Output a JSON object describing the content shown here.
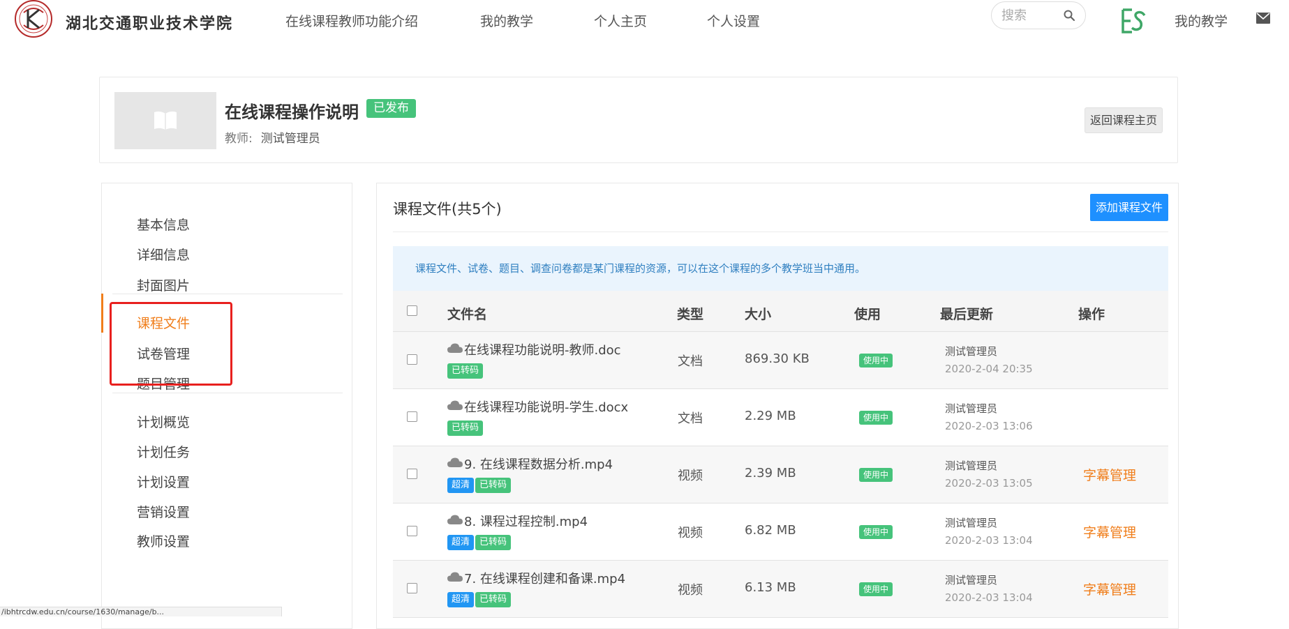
{
  "header": {
    "school_name": "湖北交通职业技术学院",
    "nav": [
      "在线课程教师功能介绍",
      "我的教学",
      "个人主页",
      "个人设置"
    ],
    "search_placeholder": "搜索",
    "my_teaching": "我的教学"
  },
  "course": {
    "title": "在线课程操作说明",
    "status": "已发布",
    "teacher_label": "教师:",
    "teacher_name": "测试管理员",
    "back_label": "返回课程主页"
  },
  "sidebar": {
    "items": [
      "基本信息",
      "详细信息",
      "封面图片",
      "课程文件",
      "试卷管理",
      "题目管理",
      "计划概览",
      "计划任务",
      "计划设置",
      "营销设置",
      "教师设置"
    ],
    "active": "课程文件"
  },
  "main": {
    "title": "课程文件(共5个)",
    "add_label": "添加课程文件",
    "notice": "课程文件、试卷、题目、调查问卷都是某门课程的资源，可以在这个课程的多个教学班当中通用。",
    "columns": [
      "文件名",
      "类型",
      "大小",
      "使用",
      "最后更新",
      "操作"
    ],
    "rows": [
      {
        "name": "在线课程功能说明-教师.doc",
        "tags": [
          "已转码"
        ],
        "type": "文档",
        "size": "869.30 KB",
        "use": "使用中",
        "updater": "测试管理员",
        "time": "2020-2-04 20:35",
        "action": ""
      },
      {
        "name": "在线课程功能说明-学生.docx",
        "tags": [
          "已转码"
        ],
        "type": "文档",
        "size": "2.29 MB",
        "use": "使用中",
        "updater": "测试管理员",
        "time": "2020-2-03 13:06",
        "action": ""
      },
      {
        "name": "9. 在线课程数据分析.mp4",
        "tags": [
          "超清",
          "已转码"
        ],
        "type": "视频",
        "size": "2.39 MB",
        "use": "使用中",
        "updater": "测试管理员",
        "time": "2020-2-03 13:05",
        "action": "字幕管理"
      },
      {
        "name": "8. 课程过程控制.mp4",
        "tags": [
          "超清",
          "已转码"
        ],
        "type": "视频",
        "size": "6.82 MB",
        "use": "使用中",
        "updater": "测试管理员",
        "time": "2020-2-03 13:04",
        "action": "字幕管理"
      },
      {
        "name": "7. 在线课程创建和备课.mp4",
        "tags": [
          "超清",
          "已转码"
        ],
        "type": "视频",
        "size": "6.13 MB",
        "use": "使用中",
        "updater": "测试管理员",
        "time": "2020-2-03 13:04",
        "action": "字幕管理"
      }
    ]
  },
  "status_url": "/ibhtrcdw.edu.cn/course/1630/manage/b...",
  "colors": {
    "accent": "#f07e1b",
    "green": "#46c37b",
    "blue": "#1e90ff",
    "annotation_red": "#e8201e"
  }
}
